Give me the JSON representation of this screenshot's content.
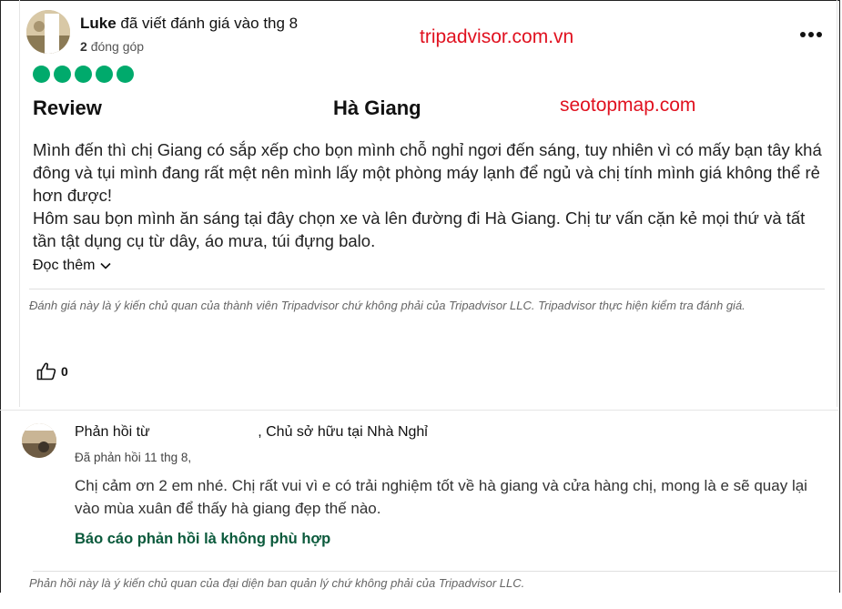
{
  "review": {
    "author_name": "Luke",
    "author_action": "đã viết đánh giá vào thg 8",
    "contributions_count": "2",
    "contributions_label": "đóng góp",
    "rating": 5,
    "title_left": "Review",
    "title_right": "Hà Giang",
    "body": [
      "Mình đến thì chị Giang có sắp xếp cho bọn mình chỗ nghỉ ngơi đến sáng, tuy nhiên vì có mấy bạn tây khá đông và tụi mình đang rất mệt nên mình lấy một phòng máy lạnh để ngủ và chị tính mình giá không thể rẻ hơn được!",
      "Hôm sau bọn mình ăn sáng tại đây chọn xe và lên đường đi Hà Giang. Chị tư vấn cặn kẻ mọi thứ và tất tần tật dụng cụ từ dây, áo mưa, túi đựng balo."
    ],
    "read_more": "Đọc thêm",
    "disclaimer": "Đánh giá này là ý kiến chủ quan của thành viên Tripadvisor chứ không phải của Tripadvisor LLC. Tripadvisor thực hiện kiểm tra đánh giá.",
    "helpful_count": "0"
  },
  "watermarks": {
    "top": "tripadvisor.com.vn",
    "middle": "seotopmap.com"
  },
  "response": {
    "prefix": "Phản hồi từ",
    "suffix": ", Chủ sở hữu tại Nhà Nghỉ",
    "date": "Đã phản hồi 11 thg 8,",
    "body": "Chị cảm ơn 2 em nhé. Chị rất vui vì e có trải nghiệm tốt về hà giang và cửa hàng chị, mong là e sẽ quay lại vào mùa xuân để thấy hà giang đẹp thế nào.",
    "report_link": "Báo cáo phản hồi là không phù hợp",
    "disclaimer": "Phản hồi này là ý kiến chủ quan của đại diện ban quản lý chứ không phải của Tripadvisor LLC."
  },
  "colors": {
    "rating_bubble": "#00aa6c",
    "watermark": "#e0111f",
    "link": "#0b5a3c"
  },
  "icons": {
    "more": "more-dots-icon",
    "chevron": "chevron-down-icon",
    "helpful": "thumbs-up-icon"
  }
}
